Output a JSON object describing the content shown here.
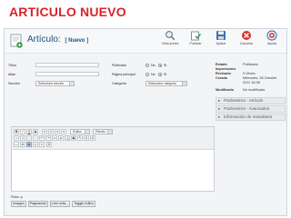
{
  "slide_title": "ARTICULO NUEVO",
  "page": {
    "title": "Artículo:",
    "subtitle": "[ Nuevo ]"
  },
  "toolbar": [
    {
      "label": "Vista previa",
      "icon": "preview-icon"
    },
    {
      "label": "Publicar",
      "icon": "publish-icon"
    },
    {
      "label": "Aplicar",
      "icon": "apply-icon"
    },
    {
      "label": "Cancelar",
      "icon": "cancel-icon"
    },
    {
      "label": "Ayuda",
      "icon": "help-icon"
    }
  ],
  "fields": {
    "titulo": "Título",
    "alias": "Alias",
    "seccion": "Sección",
    "seccion_value": "Seleccione sección",
    "publicado": "Publicado",
    "pagina_principal": "Página principal",
    "categoria": "Categoría",
    "categoria_value": "Seleccione categoría",
    "no": "No",
    "si": "Sí"
  },
  "editor": {
    "style_select": "Estilos",
    "format_select": "Párrafo",
    "path": "Ruta: p"
  },
  "buttons": [
    "Imagen",
    "Paginación",
    "Leer más...",
    "Toggle editor"
  ],
  "details": {
    "estado_label": "Estado",
    "estado_value": "Publicado",
    "impresiones_label": "Impresiones",
    "revisado_label": "Revisado",
    "revisado_value": "0 Veces",
    "creado_label": "Creado",
    "creado_value": "Miércoles, 26 Octubre 2011 16:38",
    "modificado_label": "Modificado",
    "modificado_value": "No modificado"
  },
  "panes": [
    "Parámetros - Artículo",
    "Parámetros - Avanzados",
    "Información de metadatos"
  ],
  "colors": {
    "slide_title": "#d8232a",
    "page_title": "#1d4f8c"
  }
}
